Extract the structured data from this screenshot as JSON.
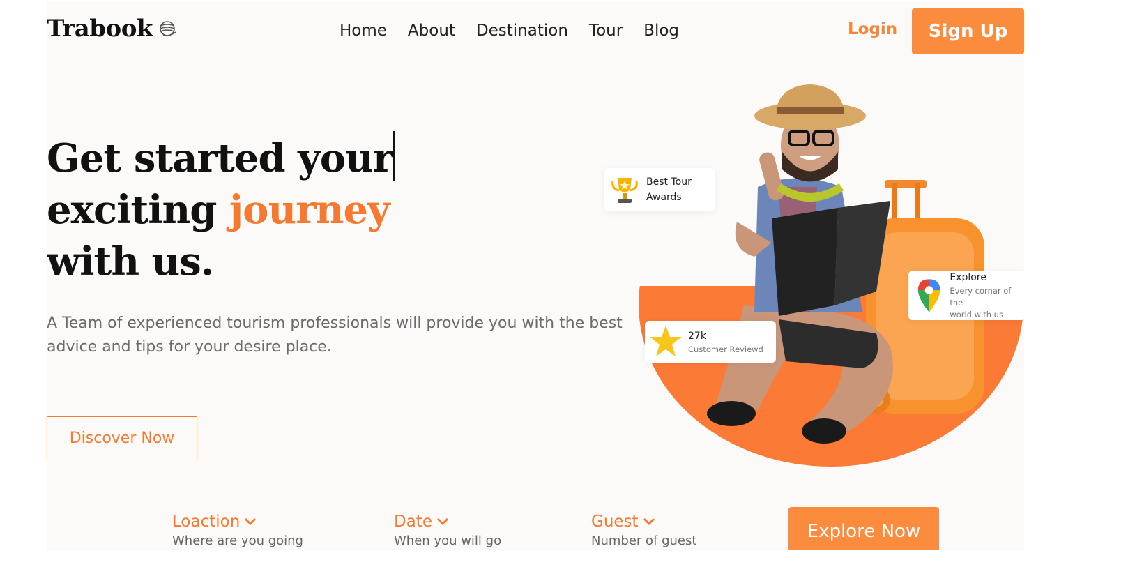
{
  "header": {
    "logo": "Trabook",
    "nav": [
      "Home",
      "About",
      "Destination",
      "Tour",
      "Blog"
    ],
    "login": "Login",
    "signup": "Sign Up"
  },
  "hero": {
    "title_line1": "Get started your",
    "title_line2a": "exciting ",
    "title_line2b": "journey",
    "title_line3": "with us.",
    "description": "A Team of experienced tourism professionals will provide you with the best advice and tips for your desire place.",
    "cta": "Discover Now"
  },
  "badges": {
    "award": {
      "line1": "Best Tour",
      "line2": "Awards",
      "icon": "trophy-icon"
    },
    "review": {
      "count": "27k",
      "label": "Customer Reviewd",
      "icon": "star-icon"
    },
    "explore": {
      "title": "Explore",
      "line1": "Every cornar of the",
      "line2": "world with us",
      "icon": "map-pin-icon"
    }
  },
  "search": {
    "location": {
      "label": "Loaction",
      "hint": "Where are you going"
    },
    "date": {
      "label": "Date",
      "hint": "When you will go"
    },
    "guest": {
      "label": "Guest",
      "hint": "Number of guest"
    },
    "button": "Explore Now"
  },
  "colors": {
    "accent": "#f47a32",
    "button": "#fb8c3e",
    "background": "#fcfaf8"
  }
}
